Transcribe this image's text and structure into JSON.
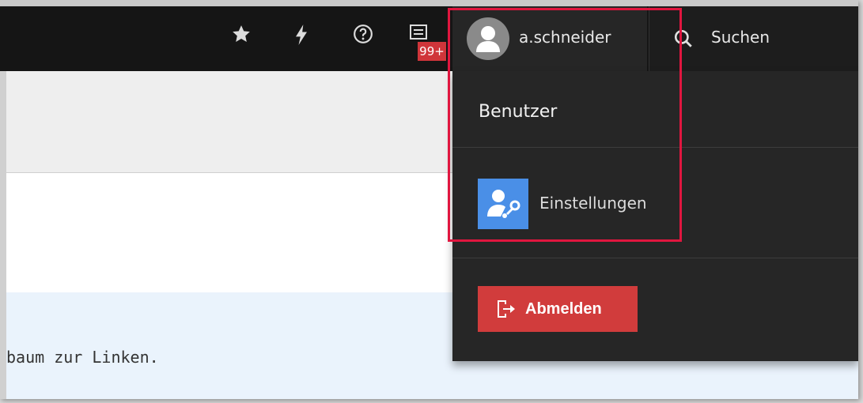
{
  "topbar": {
    "notification_badge": "99+",
    "username": "a.schneider",
    "search_label": "Suchen",
    "icons": [
      "star-icon",
      "lightning-icon",
      "help-icon",
      "notifications-icon"
    ]
  },
  "content": {
    "hint_text": "baum zur Linken."
  },
  "user_menu": {
    "header": "Benutzer",
    "settings_label": "Einstellungen",
    "logout_label": "Abmelden",
    "accent_color": "#4a8fe7",
    "logout_color": "#d13c3c",
    "highlight_color": "#e0163f"
  }
}
